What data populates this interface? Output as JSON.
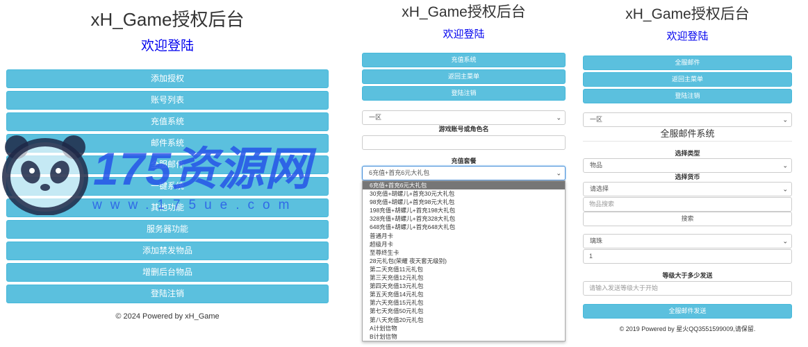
{
  "panel1": {
    "title": "xH_Game授权后台",
    "subtitle": "欢迎登陆",
    "buttons": [
      "添加授权",
      "账号列表",
      "充值系统",
      "邮件系统",
      "全服邮件",
      "一键系统",
      "其他功能",
      "服务器功能",
      "添加禁发物品",
      "增删后台物品",
      "登陆注销"
    ],
    "footer": "© 2024 Powered by xH_Game"
  },
  "panel2": {
    "title": "xH_Game授权后台",
    "subtitle": "欢迎登陆",
    "buttons": [
      "充值系统",
      "返回主菜单",
      "登陆注销"
    ],
    "server_select": "一区",
    "account_label": "游戏账号或角色名",
    "account_value": "",
    "package_label": "充值套餐",
    "package_select": "6充值+首充6元大礼包",
    "dropdown_options": [
      "6充值+首充6元大礼包",
      "30充值+胡螺儿+首充30元大礼包",
      "98充值+胡螺儿+首充98元大礼包",
      "198充值+胡螺儿+首充198大礼包",
      "328充值+胡螺儿+首充328大礼包",
      "648充值+胡螺儿+首充648大礼包",
      "普通月卡",
      "超级月卡",
      "至尊终生卡",
      "28元礼包(荣耀 夜天套无级别)",
      "第二天充值11元礼包",
      "第三天充值12元礼包",
      "第四天充值13元礼包",
      "第五天充值14元礼包",
      "第六天充值15元礼包",
      "第七天充值50元礼包",
      "第八天充值20元礼包",
      "A计划信物",
      "B计划信物"
    ]
  },
  "panel3": {
    "title": "xH_Game授权后台",
    "subtitle": "欢迎登陆",
    "buttons": [
      "全服邮件",
      "返回主菜单",
      "登陆注销"
    ],
    "server_select": "一区",
    "section_title": "全服邮件系统",
    "type_label": "选择类型",
    "type_select": "物品",
    "currency_label": "选择货币",
    "currency_select": "请选择",
    "search_placeholder": "物品搜索",
    "search_button": "搜索",
    "item_select": "璃珠",
    "quantity_value": "1",
    "level_label": "等级大于多少发送",
    "level_placeholder": "请输入发送等级大于开始",
    "send_button": "全服邮件发送",
    "footer": "© 2019 Powered by 星火QQ3551599009,请保留."
  },
  "watermark": {
    "text": "175资源网",
    "url": "www.175ue.com"
  },
  "icons": {
    "chevron": "chevron-down-icon",
    "panda": "panda-logo-icon"
  },
  "colors": {
    "button": "#5bc0de",
    "subtitle": "#0000ee",
    "watermark": "#2654e8"
  }
}
